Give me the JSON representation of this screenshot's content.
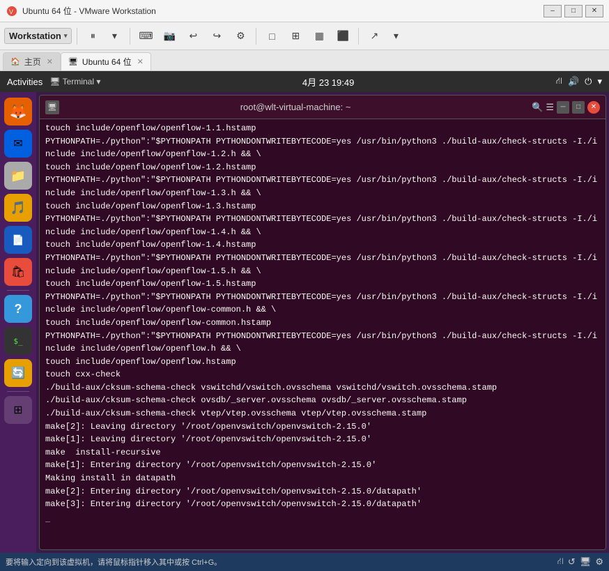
{
  "titleBar": {
    "title": "Ubuntu 64 位 - VMware Workstation",
    "iconColor": "#e74c3c"
  },
  "toolbar": {
    "workstationLabel": "Workstation",
    "buttons": [
      "⏸",
      "▶",
      "⏭",
      "🖥",
      "📷",
      "↩",
      "↪",
      "⚙",
      "□",
      "⊞",
      "⊡",
      "⬛",
      "↗"
    ]
  },
  "tabs": [
    {
      "id": "home",
      "label": "主页",
      "icon": "🏠",
      "closable": true,
      "active": false
    },
    {
      "id": "ubuntu",
      "label": "Ubuntu 64 位",
      "icon": "🖥",
      "closable": true,
      "active": true
    }
  ],
  "gnome": {
    "activities": "Activities",
    "terminal": "Terminal",
    "clock": "4月 23  19:49",
    "icons": [
      "⛙",
      "🔊",
      "⏻",
      "▼"
    ]
  },
  "terminal": {
    "title": "root@wlt-virtual-machine: ~",
    "lines": [
      "touch include/openflow/openflow-1.1.hstamp",
      "PYTHONPATH=./python\":\"$PYTHONPATH PYTHONDONTWRITEBYTECODE=yes /usr/bin/python3 ./build-aux/check-structs -I./include include/openflow/openflow-1.2.h && \\",
      "touch include/openflow/openflow-1.2.hstamp",
      "PYTHONPATH=./python\":\"$PYTHONPATH PYTHONDONTWRITEBYTECODE=yes /usr/bin/python3 ./build-aux/check-structs -I./include include/openflow/openflow-1.3.h && \\",
      "touch include/openflow/openflow-1.3.hstamp",
      "PYTHONPATH=./python\":\"$PYTHONPATH PYTHONDONTWRITEBYTECODE=yes /usr/bin/python3 ./build-aux/check-structs -I./include include/openflow/openflow-1.4.h && \\",
      "touch include/openflow/openflow-1.4.hstamp",
      "PYTHONPATH=./python\":\"$PYTHONPATH PYTHONDONTWRITEBYTECODE=yes /usr/bin/python3 ./build-aux/check-structs -I./include include/openflow/openflow-1.5.h && \\",
      "touch include/openflow/openflow-1.5.hstamp",
      "PYTHONPATH=./python\":\"$PYTHONPATH PYTHONDONTWRITEBYTECODE=yes /usr/bin/python3 ./build-aux/check-structs -I./include include/openflow/openflow-common.h && \\",
      "touch include/openflow/openflow-common.hstamp",
      "PYTHONPATH=./python\":\"$PYTHONPATH PYTHONDONTWRITEBYTECODE=yes /usr/bin/python3 ./build-aux/check-structs -I./include include/openflow/openflow.h && \\",
      "touch include/openflow/openflow.hstamp",
      "touch cxx-check",
      "./build-aux/cksum-schema-check vswitchd/vswitch.ovsschema vswitchd/vswitch.ovsschema.stamp",
      "./build-aux/cksum-schema-check ovsdb/_server.ovsschema ovsdb/_server.ovsschema.stamp",
      "./build-aux/cksum-schema-check vtep/vtep.ovsschema vtep/vtep.ovsschema.stamp",
      "make[2]: Leaving directory '/root/openvswitch/openvswitch-2.15.0'",
      "make[1]: Leaving directory '/root/openvswitch/openvswitch-2.15.0'",
      "make  install-recursive",
      "make[1]: Entering directory '/root/openvswitch/openvswitch-2.15.0'",
      "Making install in datapath",
      "make[2]: Entering directory '/root/openvswitch/openvswitch-2.15.0/datapath'",
      "make[3]: Entering directory '/root/openvswitch/openvswitch-2.15.0/datapath'"
    ]
  },
  "launcher": {
    "items": [
      {
        "name": "firefox",
        "emoji": "🦊",
        "label": "Firefox"
      },
      {
        "name": "thunderbird",
        "emoji": "✉",
        "label": "Thunderbird"
      },
      {
        "name": "files",
        "emoji": "📁",
        "label": "Files"
      },
      {
        "name": "rhythmbox",
        "emoji": "🎵",
        "label": "Rhythmbox"
      },
      {
        "name": "libreoffice",
        "emoji": "📄",
        "label": "LibreOffice"
      },
      {
        "name": "software",
        "emoji": "🛍",
        "label": "Software"
      },
      {
        "name": "help",
        "emoji": "?",
        "label": "Help"
      },
      {
        "name": "terminal",
        "emoji": ">_",
        "label": "Terminal"
      },
      {
        "name": "updates",
        "emoji": "🔄",
        "label": "Updates"
      },
      {
        "name": "grid",
        "emoji": "⊞",
        "label": "Apps"
      }
    ]
  },
  "statusBar": {
    "text": "要将输入定向到该虚拟机，请将鼠标指针移入其中或按 Ctrl+G。",
    "icons": [
      "⛙",
      "↺",
      "🖥",
      "⚙"
    ]
  }
}
